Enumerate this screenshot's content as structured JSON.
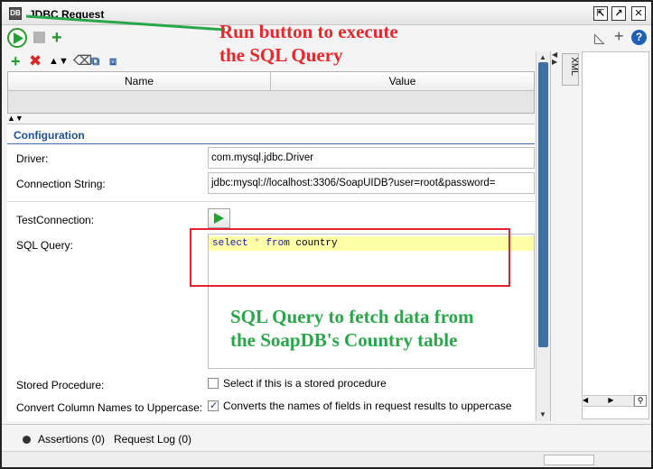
{
  "window": {
    "title": "JDBC Request",
    "title_icon": "jdbc-icon",
    "buttons": [
      "restore-icon",
      "maximize-icon",
      "close-icon"
    ]
  },
  "toolbar": {
    "run_icon": "play-icon",
    "stop_icon": "stop-icon",
    "add_icon": "plus-icon",
    "right_icons": [
      "wand-icon",
      "plus-icon",
      "help-icon"
    ],
    "help_label": "?"
  },
  "properties": {
    "toolbar_icons": [
      "add-icon",
      "delete-icon",
      "move-up-icon",
      "move-down-icon",
      "clear-icon",
      "copy-icon",
      "paste-icon"
    ],
    "columns": [
      "Name",
      "Value"
    ]
  },
  "configuration": {
    "title": "Configuration",
    "driver_label": "Driver:",
    "driver_value": "com.mysql.jdbc.Driver",
    "connection_label": "Connection String:",
    "connection_value": "jdbc:mysql://localhost:3306/SoapUIDB?user=root&password=",
    "test_label": "TestConnection:",
    "sql_label": "SQL Query:",
    "sql_select": "select",
    "sql_star": " * ",
    "sql_from": "from",
    "sql_table": " country",
    "stored_label": "Stored Procedure:",
    "stored_checkbox_label": "Select if this is a stored procedure",
    "stored_checked": false,
    "uppercase_label": "Convert Column Names to Uppercase:",
    "uppercase_checkbox_label": "Converts the names of fields in request results to uppercase",
    "uppercase_checked": true
  },
  "right_panel": {
    "xml_tab": "XML"
  },
  "bottom_tabs": {
    "assertions": "Assertions (0)",
    "request_log": "Request Log (0)"
  },
  "annotations": {
    "run_line1": "Run button to execute",
    "run_line2": "the SQL Query",
    "sql_line1": "SQL Query to fetch data from",
    "sql_line2": "the SoapDB's Country table",
    "run_color": "#e8272d",
    "sql_color": "#2aa64a",
    "box_color": "#e3232c"
  }
}
